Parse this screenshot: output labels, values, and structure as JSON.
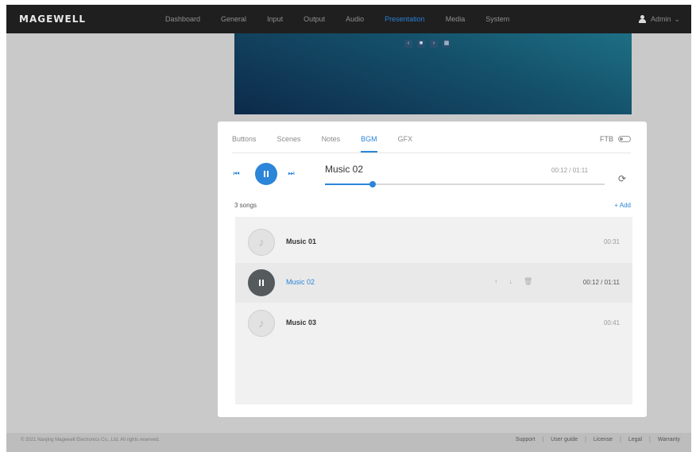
{
  "brand": {
    "logo": "MAGEWELL",
    "accent": "#2b85d8"
  },
  "nav": {
    "items": [
      {
        "label": "Dashboard",
        "active": false
      },
      {
        "label": "General",
        "active": false
      },
      {
        "label": "Input",
        "active": false
      },
      {
        "label": "Output",
        "active": false
      },
      {
        "label": "Audio",
        "active": false
      },
      {
        "label": "Presentation",
        "active": true
      },
      {
        "label": "Media",
        "active": false
      },
      {
        "label": "System",
        "active": false
      }
    ],
    "user": "Admin"
  },
  "preview": {
    "controls": [
      "‹",
      "■",
      "›",
      "▦"
    ]
  },
  "panel": {
    "tabs": [
      {
        "label": "Buttons",
        "active": false
      },
      {
        "label": "Scenes",
        "active": false
      },
      {
        "label": "Notes",
        "active": false
      },
      {
        "label": "BGM",
        "active": true
      },
      {
        "label": "GFX",
        "active": false
      }
    ],
    "fts_label": "FTB",
    "fts_on": false,
    "player": {
      "title": "Music 02",
      "time": "00:12 / 01:11",
      "progress": 0.17
    },
    "song_count": "3 songs",
    "add_label": "+ Add",
    "songs": [
      {
        "name": "Music 01",
        "duration": "00:31",
        "playing": false
      },
      {
        "name": "Music 02",
        "duration": "00:12 / 01:11",
        "playing": true
      },
      {
        "name": "Music 03",
        "duration": "00:41",
        "playing": false
      }
    ]
  },
  "footer": {
    "copyright": "© 2021 Nanjing Magewell Electronics Co., Ltd. All rights reserved.",
    "links": [
      "Support",
      "User guide",
      "License",
      "Legal",
      "Warranty"
    ]
  },
  "icons": {
    "prev": "skip-previous-icon",
    "next": "skip-next-icon",
    "pause": "pause-icon",
    "loop": "repeat-icon",
    "note": "music-note-icon",
    "up": "arrow-up-icon",
    "down": "arrow-down-icon",
    "delete": "trash-icon"
  }
}
